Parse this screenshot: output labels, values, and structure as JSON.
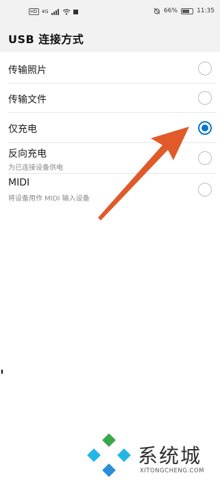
{
  "status_bar": {
    "left_hd": "HD",
    "network": "4G",
    "alarm_icon": "alarm-off-icon",
    "battery_percent": "66%",
    "time": "11:35"
  },
  "page": {
    "title": "USB 连接方式"
  },
  "options": [
    {
      "label": "传输照片",
      "sublabel": "",
      "selected": false
    },
    {
      "label": "传输文件",
      "sublabel": "",
      "selected": false
    },
    {
      "label": "仅充电",
      "sublabel": "",
      "selected": true
    },
    {
      "label": "反向充电",
      "sublabel": "为已连接设备供电",
      "selected": false
    },
    {
      "label": "MIDI",
      "sublabel": "将设备用作 MIDI 输入设备",
      "selected": false
    }
  ],
  "annotation": {
    "arrow_color": "#e05a2a"
  },
  "watermark": {
    "name": "系统城",
    "url": "XITONGCHENG.COM",
    "colors": {
      "green": "#3aa64a",
      "blue": "#2a8fd6",
      "cyan": "#23b7e5"
    }
  },
  "accent_color": "#0a74c9"
}
